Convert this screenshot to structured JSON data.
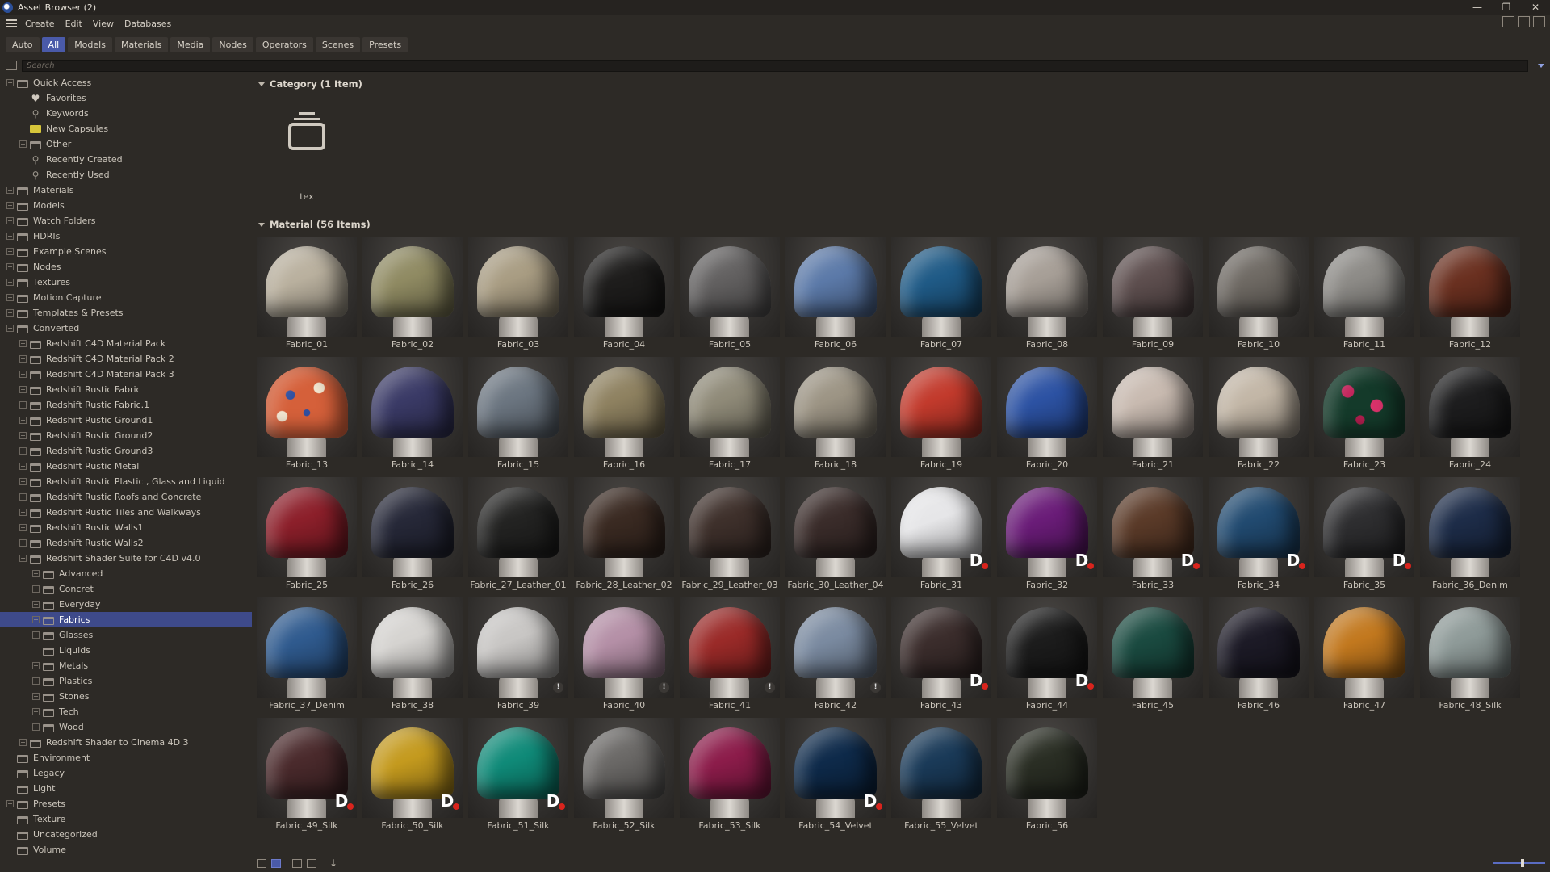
{
  "window": {
    "title": "Asset Browser (2)",
    "minimize_icon": "minimize-icon",
    "restore_icon": "restore-icon",
    "close_icon": "close-icon"
  },
  "menu": [
    "Create",
    "Edit",
    "View",
    "Databases"
  ],
  "tabs": [
    {
      "label": "Auto",
      "active": false
    },
    {
      "label": "All",
      "active": true
    },
    {
      "label": "Models",
      "active": false
    },
    {
      "label": "Materials",
      "active": false
    },
    {
      "label": "Media",
      "active": false
    },
    {
      "label": "Nodes",
      "active": false
    },
    {
      "label": "Operators",
      "active": false
    },
    {
      "label": "Scenes",
      "active": false
    },
    {
      "label": "Presets",
      "active": false
    }
  ],
  "search": {
    "placeholder": "Search"
  },
  "tree": [
    {
      "label": "Quick Access",
      "level": 0,
      "exp": "-",
      "icon": "db"
    },
    {
      "label": "Favorites",
      "level": 1,
      "exp": "",
      "icon": "heart"
    },
    {
      "label": "Keywords",
      "level": 1,
      "exp": "",
      "icon": "search"
    },
    {
      "label": "New Capsules",
      "level": 1,
      "exp": "",
      "icon": "folder"
    },
    {
      "label": "Other",
      "level": 1,
      "exp": "+",
      "icon": "db"
    },
    {
      "label": "Recently Created",
      "level": 1,
      "exp": "",
      "icon": "search"
    },
    {
      "label": "Recently Used",
      "level": 1,
      "exp": "",
      "icon": "search"
    },
    {
      "label": "Materials",
      "level": 0,
      "exp": "+",
      "icon": "db"
    },
    {
      "label": "Models",
      "level": 0,
      "exp": "+",
      "icon": "db"
    },
    {
      "label": "Watch Folders",
      "level": 0,
      "exp": "+",
      "icon": "db"
    },
    {
      "label": "HDRIs",
      "level": 0,
      "exp": "+",
      "icon": "db"
    },
    {
      "label": "Example Scenes",
      "level": 0,
      "exp": "+",
      "icon": "db"
    },
    {
      "label": "Nodes",
      "level": 0,
      "exp": "+",
      "icon": "db"
    },
    {
      "label": "Textures",
      "level": 0,
      "exp": "+",
      "icon": "db"
    },
    {
      "label": "Motion Capture",
      "level": 0,
      "exp": "+",
      "icon": "db"
    },
    {
      "label": "Templates & Presets",
      "level": 0,
      "exp": "+",
      "icon": "db"
    },
    {
      "label": "Converted",
      "level": 0,
      "exp": "-",
      "icon": "db"
    },
    {
      "label": "Redshift C4D Material Pack",
      "level": 1,
      "exp": "+",
      "icon": "db"
    },
    {
      "label": "Redshift C4D Material Pack 2",
      "level": 1,
      "exp": "+",
      "icon": "db"
    },
    {
      "label": "Redshift C4D Material Pack 3",
      "level": 1,
      "exp": "+",
      "icon": "db"
    },
    {
      "label": "Redshift Rustic Fabric",
      "level": 1,
      "exp": "+",
      "icon": "db"
    },
    {
      "label": "Redshift Rustic Fabric.1",
      "level": 1,
      "exp": "+",
      "icon": "db"
    },
    {
      "label": "Redshift Rustic Ground1",
      "level": 1,
      "exp": "+",
      "icon": "db"
    },
    {
      "label": "Redshift Rustic Ground2",
      "level": 1,
      "exp": "+",
      "icon": "db"
    },
    {
      "label": "Redshift Rustic Ground3",
      "level": 1,
      "exp": "+",
      "icon": "db"
    },
    {
      "label": "Redshift Rustic Metal",
      "level": 1,
      "exp": "+",
      "icon": "db"
    },
    {
      "label": "Redshift Rustic Plastic , Glass and Liquid",
      "level": 1,
      "exp": "+",
      "icon": "db"
    },
    {
      "label": "Redshift Rustic Roofs and Concrete",
      "level": 1,
      "exp": "+",
      "icon": "db"
    },
    {
      "label": "Redshift Rustic Tiles and Walkways",
      "level": 1,
      "exp": "+",
      "icon": "db"
    },
    {
      "label": "Redshift Rustic Walls1",
      "level": 1,
      "exp": "+",
      "icon": "db"
    },
    {
      "label": "Redshift Rustic Walls2",
      "level": 1,
      "exp": "+",
      "icon": "db"
    },
    {
      "label": "Redshift Shader Suite for C4D v4.0",
      "level": 1,
      "exp": "-",
      "icon": "db"
    },
    {
      "label": "Advanced",
      "level": 2,
      "exp": "+",
      "icon": "db"
    },
    {
      "label": "Concret",
      "level": 2,
      "exp": "+",
      "icon": "db"
    },
    {
      "label": "Everyday",
      "level": 2,
      "exp": "+",
      "icon": "db"
    },
    {
      "label": "Fabrics",
      "level": 2,
      "exp": "+",
      "icon": "db",
      "selected": true
    },
    {
      "label": "Glasses",
      "level": 2,
      "exp": "+",
      "icon": "db"
    },
    {
      "label": "Liquids",
      "level": 2,
      "exp": "",
      "icon": "db"
    },
    {
      "label": "Metals",
      "level": 2,
      "exp": "+",
      "icon": "db"
    },
    {
      "label": "Plastics",
      "level": 2,
      "exp": "+",
      "icon": "db"
    },
    {
      "label": "Stones",
      "level": 2,
      "exp": "+",
      "icon": "db"
    },
    {
      "label": "Tech",
      "level": 2,
      "exp": "+",
      "icon": "db"
    },
    {
      "label": "Wood",
      "level": 2,
      "exp": "+",
      "icon": "db"
    },
    {
      "label": "Redshift Shader to Cinema 4D 3",
      "level": 1,
      "exp": "+",
      "icon": "db"
    },
    {
      "label": "Environment",
      "level": 0,
      "exp": "",
      "icon": "db"
    },
    {
      "label": "Legacy",
      "level": 0,
      "exp": "",
      "icon": "db"
    },
    {
      "label": "Light",
      "level": 0,
      "exp": "",
      "icon": "db"
    },
    {
      "label": "Presets",
      "level": 0,
      "exp": "+",
      "icon": "db"
    },
    {
      "label": "Texture",
      "level": 0,
      "exp": "",
      "icon": "db"
    },
    {
      "label": "Uncategorized",
      "level": 0,
      "exp": "",
      "icon": "db"
    },
    {
      "label": "Volume",
      "level": 0,
      "exp": "",
      "icon": "db"
    }
  ],
  "category_section": {
    "header": "Category (1 Item)",
    "item_label": "tex"
  },
  "material_section": {
    "header": "Material (56 Items)"
  },
  "materials": [
    {
      "name": "Fabric_01",
      "color": "#b9b09e"
    },
    {
      "name": "Fabric_02",
      "color": "#8f8a62"
    },
    {
      "name": "Fabric_03",
      "color": "#a89c82"
    },
    {
      "name": "Fabric_04",
      "color": "#1e1d1c"
    },
    {
      "name": "Fabric_05",
      "color": "#626060"
    },
    {
      "name": "Fabric_06",
      "color": "#5b79a8"
    },
    {
      "name": "Fabric_07",
      "color": "#1f5a86"
    },
    {
      "name": "Fabric_08",
      "color": "#a69e96"
    },
    {
      "name": "Fabric_09",
      "color": "#5d4e4e"
    },
    {
      "name": "Fabric_10",
      "color": "#6e6963"
    },
    {
      "name": "Fabric_11",
      "color": "#8c8a86"
    },
    {
      "name": "Fabric_12",
      "color": "#6a3020"
    },
    {
      "name": "Fabric_13",
      "color": "#d5603a",
      "pattern": "floral"
    },
    {
      "name": "Fabric_14",
      "color": "#3a3a66"
    },
    {
      "name": "Fabric_15",
      "color": "#6b7580"
    },
    {
      "name": "Fabric_16",
      "color": "#8e8160"
    },
    {
      "name": "Fabric_17",
      "color": "#8f8a78"
    },
    {
      "name": "Fabric_18",
      "color": "#9c9484"
    },
    {
      "name": "Fabric_19",
      "color": "#c23a2c"
    },
    {
      "name": "Fabric_20",
      "color": "#2c52a3"
    },
    {
      "name": "Fabric_21",
      "color": "#c8bab0"
    },
    {
      "name": "Fabric_22",
      "color": "#c2b6a6"
    },
    {
      "name": "Fabric_23",
      "color": "#2a6a4a",
      "pattern": "floral2"
    },
    {
      "name": "Fabric_24",
      "color": "#1d1d1e"
    },
    {
      "name": "Fabric_25",
      "color": "#8c1f2a"
    },
    {
      "name": "Fabric_26",
      "color": "#262838"
    },
    {
      "name": "Fabric_27_Leather_01",
      "color": "#232322"
    },
    {
      "name": "Fabric_28_Leather_02",
      "color": "#3a2a22"
    },
    {
      "name": "Fabric_29_Leather_03",
      "color": "#3e302b"
    },
    {
      "name": "Fabric_30_Leather_04",
      "color": "#3a2c2a"
    },
    {
      "name": "Fabric_31",
      "color": "#e6e6e8",
      "badge": "D"
    },
    {
      "name": "Fabric_32",
      "color": "#6a1c78",
      "badge": "D"
    },
    {
      "name": "Fabric_33",
      "color": "#5a3a28",
      "badge": "D"
    },
    {
      "name": "Fabric_34",
      "color": "#214a70",
      "badge": "D"
    },
    {
      "name": "Fabric_35",
      "color": "#2e2e30",
      "badge": "D"
    },
    {
      "name": "Fabric_36_Denim",
      "color": "#1d2c48"
    },
    {
      "name": "Fabric_37_Denim",
      "color": "#2f5a8e"
    },
    {
      "name": "Fabric_38",
      "color": "#d5d3d0"
    },
    {
      "name": "Fabric_39",
      "color": "#c8c6c4",
      "warn": true
    },
    {
      "name": "Fabric_40",
      "color": "#b48fa6",
      "warn": true
    },
    {
      "name": "Fabric_41",
      "color": "#9a2a28",
      "warn": true
    },
    {
      "name": "Fabric_42",
      "color": "#7a8aa0",
      "warn": true
    },
    {
      "name": "Fabric_43",
      "color": "#3b2d2c",
      "badge": "D"
    },
    {
      "name": "Fabric_44",
      "color": "#1c1c1c",
      "badge": "D"
    },
    {
      "name": "Fabric_45",
      "color": "#1a4a40"
    },
    {
      "name": "Fabric_46",
      "color": "#1c1a26"
    },
    {
      "name": "Fabric_47",
      "color": "#c2781e"
    },
    {
      "name": "Fabric_48_Silk",
      "color": "#8e9a98"
    },
    {
      "name": "Fabric_49_Silk",
      "color": "#4a2a2c",
      "badge": "D"
    },
    {
      "name": "Fabric_50_Silk",
      "color": "#c49a1e",
      "badge": "D"
    },
    {
      "name": "Fabric_51_Silk",
      "color": "#0f8a78",
      "badge": "D"
    },
    {
      "name": "Fabric_52_Silk",
      "color": "#6a6866"
    },
    {
      "name": "Fabric_53_Silk",
      "color": "#8c1c4a"
    },
    {
      "name": "Fabric_54_Velvet",
      "color": "#0e2a4a",
      "badge": "D"
    },
    {
      "name": "Fabric_55_Velvet",
      "color": "#1a3a58"
    },
    {
      "name": "Fabric_56",
      "color": "#2a2e24"
    }
  ],
  "colors": {
    "accent": "#4a5aa9",
    "selection": "#3e4a8a",
    "background": "#2d2a26"
  }
}
